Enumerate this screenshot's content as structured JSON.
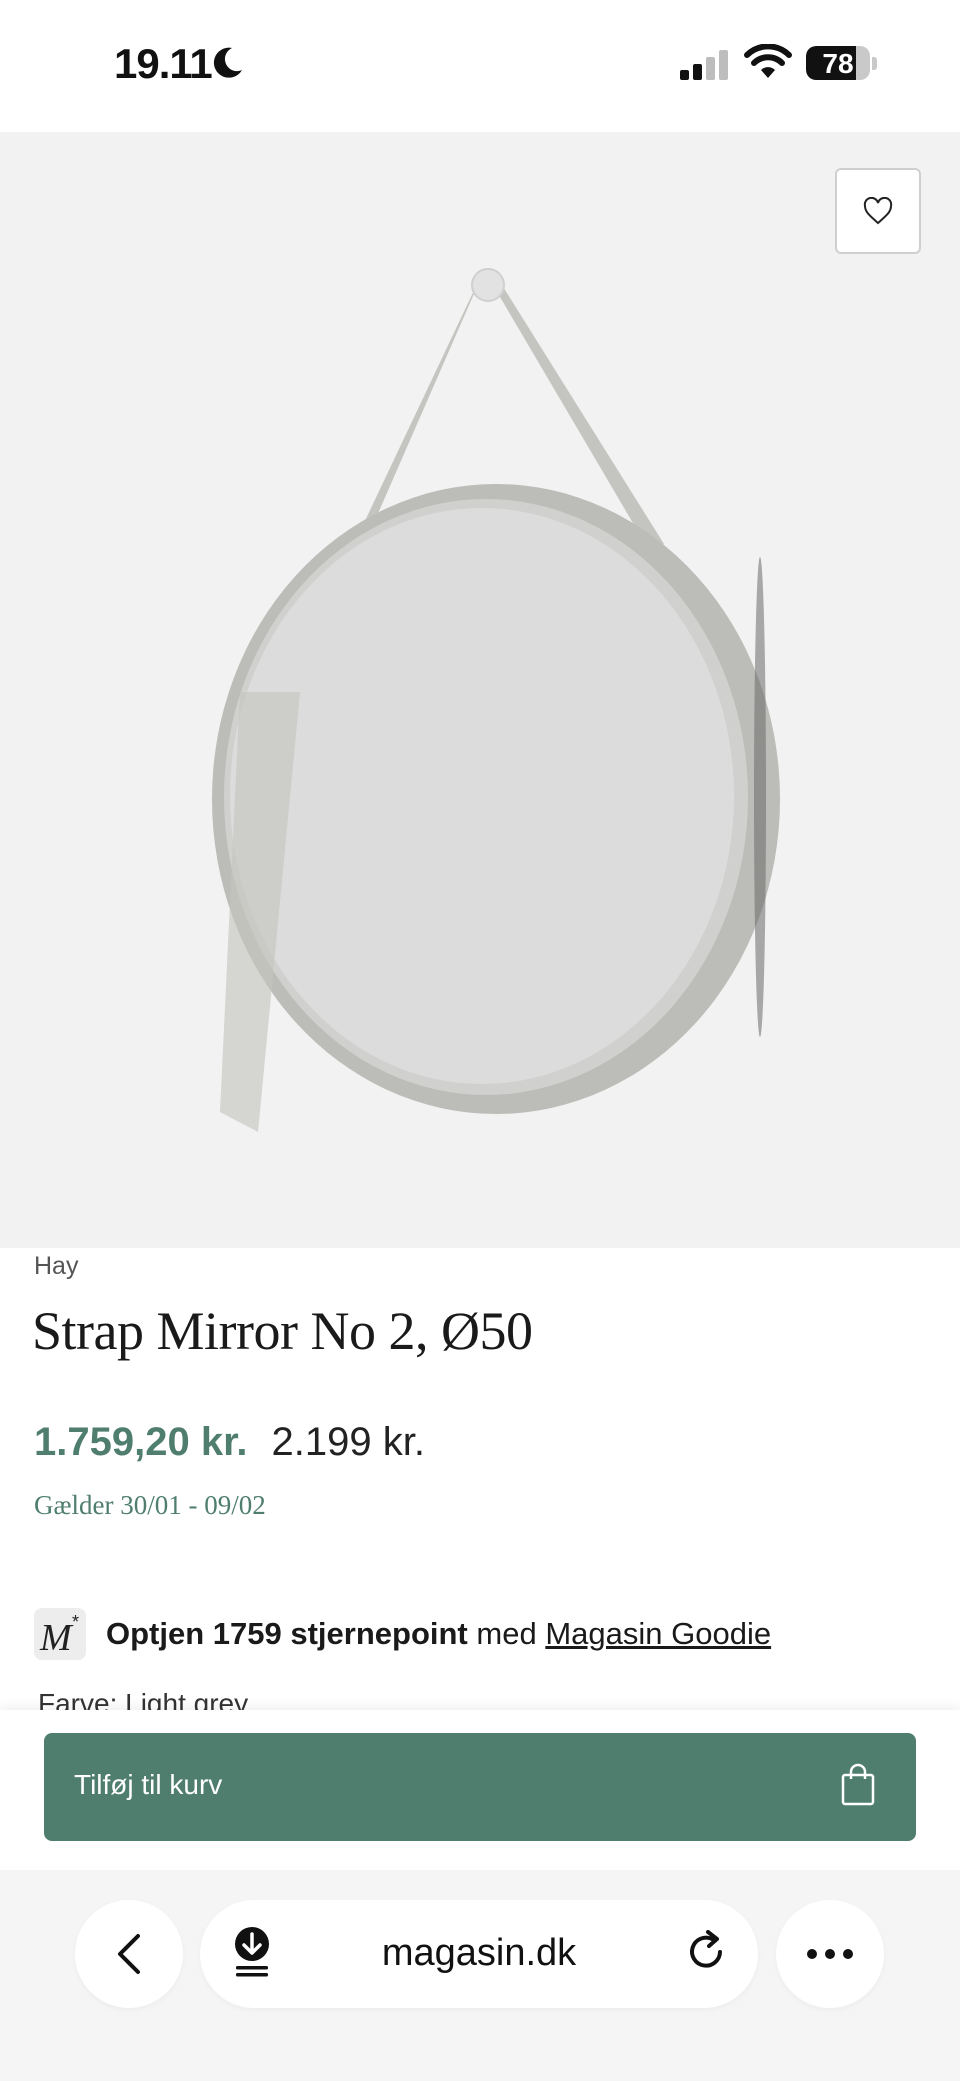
{
  "status_bar": {
    "time": "19.11",
    "battery": "78",
    "battery_level": 0.78
  },
  "product": {
    "brand": "Hay",
    "title": "Strap Mirror No 2, Ø50",
    "sale_price": "1.759,20 kr.",
    "original_price": "2.199 kr.",
    "valid_period": "Gælder 30/01 - 09/02",
    "favorite_icon": "heart-icon"
  },
  "loyalty": {
    "logo_letter": "M",
    "logo_star": "*",
    "bold_text": "Optjen 1759 stjernepoint",
    "mid_text": "med",
    "link_text": "Magasin Goodie"
  },
  "color": {
    "label": "Farve:",
    "value": "Light grey"
  },
  "cart": {
    "label": "Tilføj til kurv",
    "icon": "shopping-bag-icon"
  },
  "browser": {
    "url": "magasin.dk"
  },
  "colors": {
    "accent": "#4f7e6e",
    "image_bg": "#f2f2f2"
  }
}
